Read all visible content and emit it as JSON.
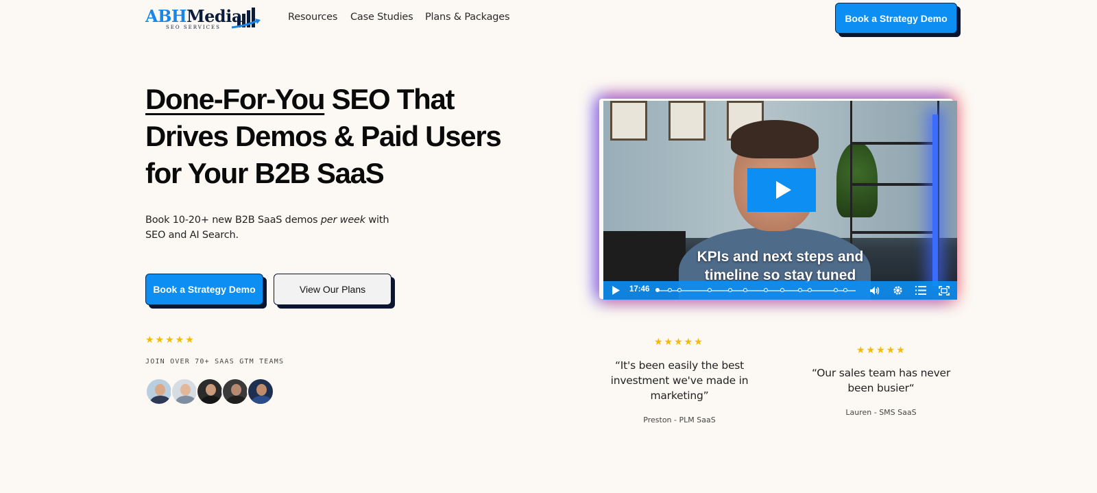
{
  "brand": {
    "name_part1": "ABH",
    "name_part2": "Media",
    "tagline": "SEO SERVICES",
    "colors": {
      "primary": "#0d8ef2",
      "dark": "#0b1530",
      "star": "#f5b90b"
    }
  },
  "nav": {
    "links": [
      "Resources",
      "Case Studies",
      "Plans & Packages"
    ],
    "cta_label": "Book a Strategy Demo"
  },
  "hero": {
    "headline_underlined": "Done-For-You",
    "headline_rest_line1": " SEO That",
    "headline_line2": "Drives Demos & Paid Users",
    "headline_line3": "for Your B2B SaaS",
    "subhead_part1": "Book 10-20+ new B2B SaaS demos ",
    "subhead_emphasis": "per week",
    "subhead_part2": " with SEO and AI Search.",
    "primary_cta": "Book a Strategy Demo",
    "secondary_cta": "View Our Plans",
    "rating_stars": "★★★★★",
    "social_proof": "JOIN OVER 70+ SAAS GTM TEAMS",
    "avatar_count": 5
  },
  "video": {
    "caption_line1": "KPIs and next steps and",
    "caption_line2": "timeline so stay tuned",
    "time": "17:46",
    "icons": [
      "play-icon",
      "volume-icon",
      "settings-icon",
      "chapters-icon",
      "fullscreen-icon"
    ]
  },
  "testimonials": [
    {
      "stars": "★★★★★",
      "quote": "“It's been easily the best investment we've made in marketing”",
      "author": "Preston - PLM SaaS"
    },
    {
      "stars": "★★★★★",
      "quote": "“Our sales team has never been busier“",
      "author": "Lauren - SMS SaaS"
    }
  ]
}
